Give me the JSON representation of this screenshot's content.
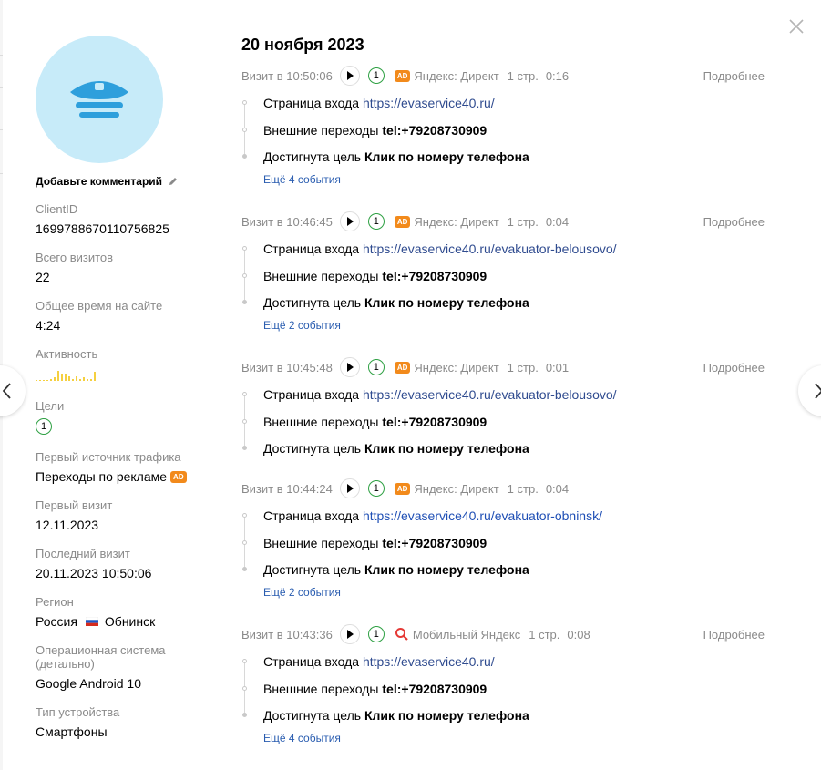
{
  "close": {
    "icon": "close-icon"
  },
  "nav": {
    "prev_icon": "chevron-left-icon",
    "next_icon": "chevron-right-icon"
  },
  "profile": {
    "avatar_icon": "police-cap-icon",
    "comment_label": "Добавьте комментарий",
    "fields": {
      "client_id": {
        "label": "ClientID",
        "value": "1699788670110756825"
      },
      "total_visits": {
        "label": "Всего визитов",
        "value": "22"
      },
      "time_on_site": {
        "label": "Общее время на сайте",
        "value": "4:24"
      },
      "activity": {
        "label": "Активность",
        "color": "#f5d040"
      },
      "goals": {
        "label": "Цели",
        "value": "1"
      },
      "first_source": {
        "label": "Первый источник трафика",
        "value": "Переходы по рекламе",
        "badge": "AD"
      },
      "first_visit": {
        "label": "Первый визит",
        "value": "12.11.2023"
      },
      "last_visit": {
        "label": "Последний визит",
        "value": "20.11.2023 10:50:06"
      },
      "region": {
        "label": "Регион",
        "country": "Россия",
        "city": "Обнинск"
      },
      "os": {
        "label_line1": "Операционная система",
        "label_line2": "(детально)",
        "value": "Google Android 10"
      },
      "device": {
        "label": "Тип устройства",
        "value": "Смартфоны"
      }
    }
  },
  "date_title": "20 ноября 2023",
  "visits": [
    {
      "time": "Визит в 10:50:06",
      "goals": "1",
      "source_badge": "AD",
      "source": "Яндекс: Директ",
      "pages": "1 стр.",
      "duration": "0:16",
      "details": "Подробнее",
      "entry_label": "Страница входа",
      "entry_url": "https://evaservice40.ru/",
      "ext_label": "Внешние переходы",
      "ext_value": "tel:+79208730909",
      "goal_label": "Достигнута цель",
      "goal_value": "Клик по номеру телефона",
      "more_events": "Ещё 4 события"
    },
    {
      "time": "Визит в 10:46:45",
      "goals": "1",
      "source_badge": "AD",
      "source": "Яндекс: Директ",
      "pages": "1 стр.",
      "duration": "0:04",
      "details": "Подробнее",
      "entry_label": "Страница входа",
      "entry_url": "https://evaservice40.ru/evakuator-belousovo/",
      "ext_label": "Внешние переходы",
      "ext_value": "tel:+79208730909",
      "goal_label": "Достигнута цель",
      "goal_value": "Клик по номеру телефона",
      "more_events": "Ещё 2 события"
    },
    {
      "time": "Визит в 10:45:48",
      "goals": "1",
      "source_badge": "AD",
      "source": "Яндекс: Директ",
      "pages": "1 стр.",
      "duration": "0:01",
      "details": "Подробнее",
      "entry_label": "Страница входа",
      "entry_url": "https://evaservice40.ru/evakuator-belousovo/",
      "ext_label": "Внешние переходы",
      "ext_value": "tel:+79208730909",
      "goal_label": "Достигнута цель",
      "goal_value": "Клик по номеру телефона"
    },
    {
      "time": "Визит в 10:44:24",
      "goals": "1",
      "source_badge": "AD",
      "source": "Яндекс: Директ",
      "pages": "1 стр.",
      "duration": "0:04",
      "details": "",
      "entry_label": "Страница входа",
      "entry_url": "https://evaservice40.ru/evakuator-obninsk/",
      "ext_label": "Внешние переходы",
      "ext_value": "tel:+79208730909",
      "goal_label": "Достигнута цель",
      "goal_value": "Клик по номеру телефона",
      "more_events": "Ещё 2 события"
    },
    {
      "time": "Визит в 10:43:36",
      "goals": "1",
      "source_icon": "search-icon",
      "source": "Мобильный Яндекс",
      "pages": "1 стр.",
      "duration": "0:08",
      "details": "Подробнее",
      "entry_label": "Страница входа",
      "entry_url": "https://evaservice40.ru/",
      "ext_label": "Внешние переходы",
      "ext_value": "tel:+79208730909",
      "goal_label": "Достигнута цель",
      "goal_value": "Клик по номеру телефона",
      "more_events": "Ещё 4 события"
    }
  ]
}
